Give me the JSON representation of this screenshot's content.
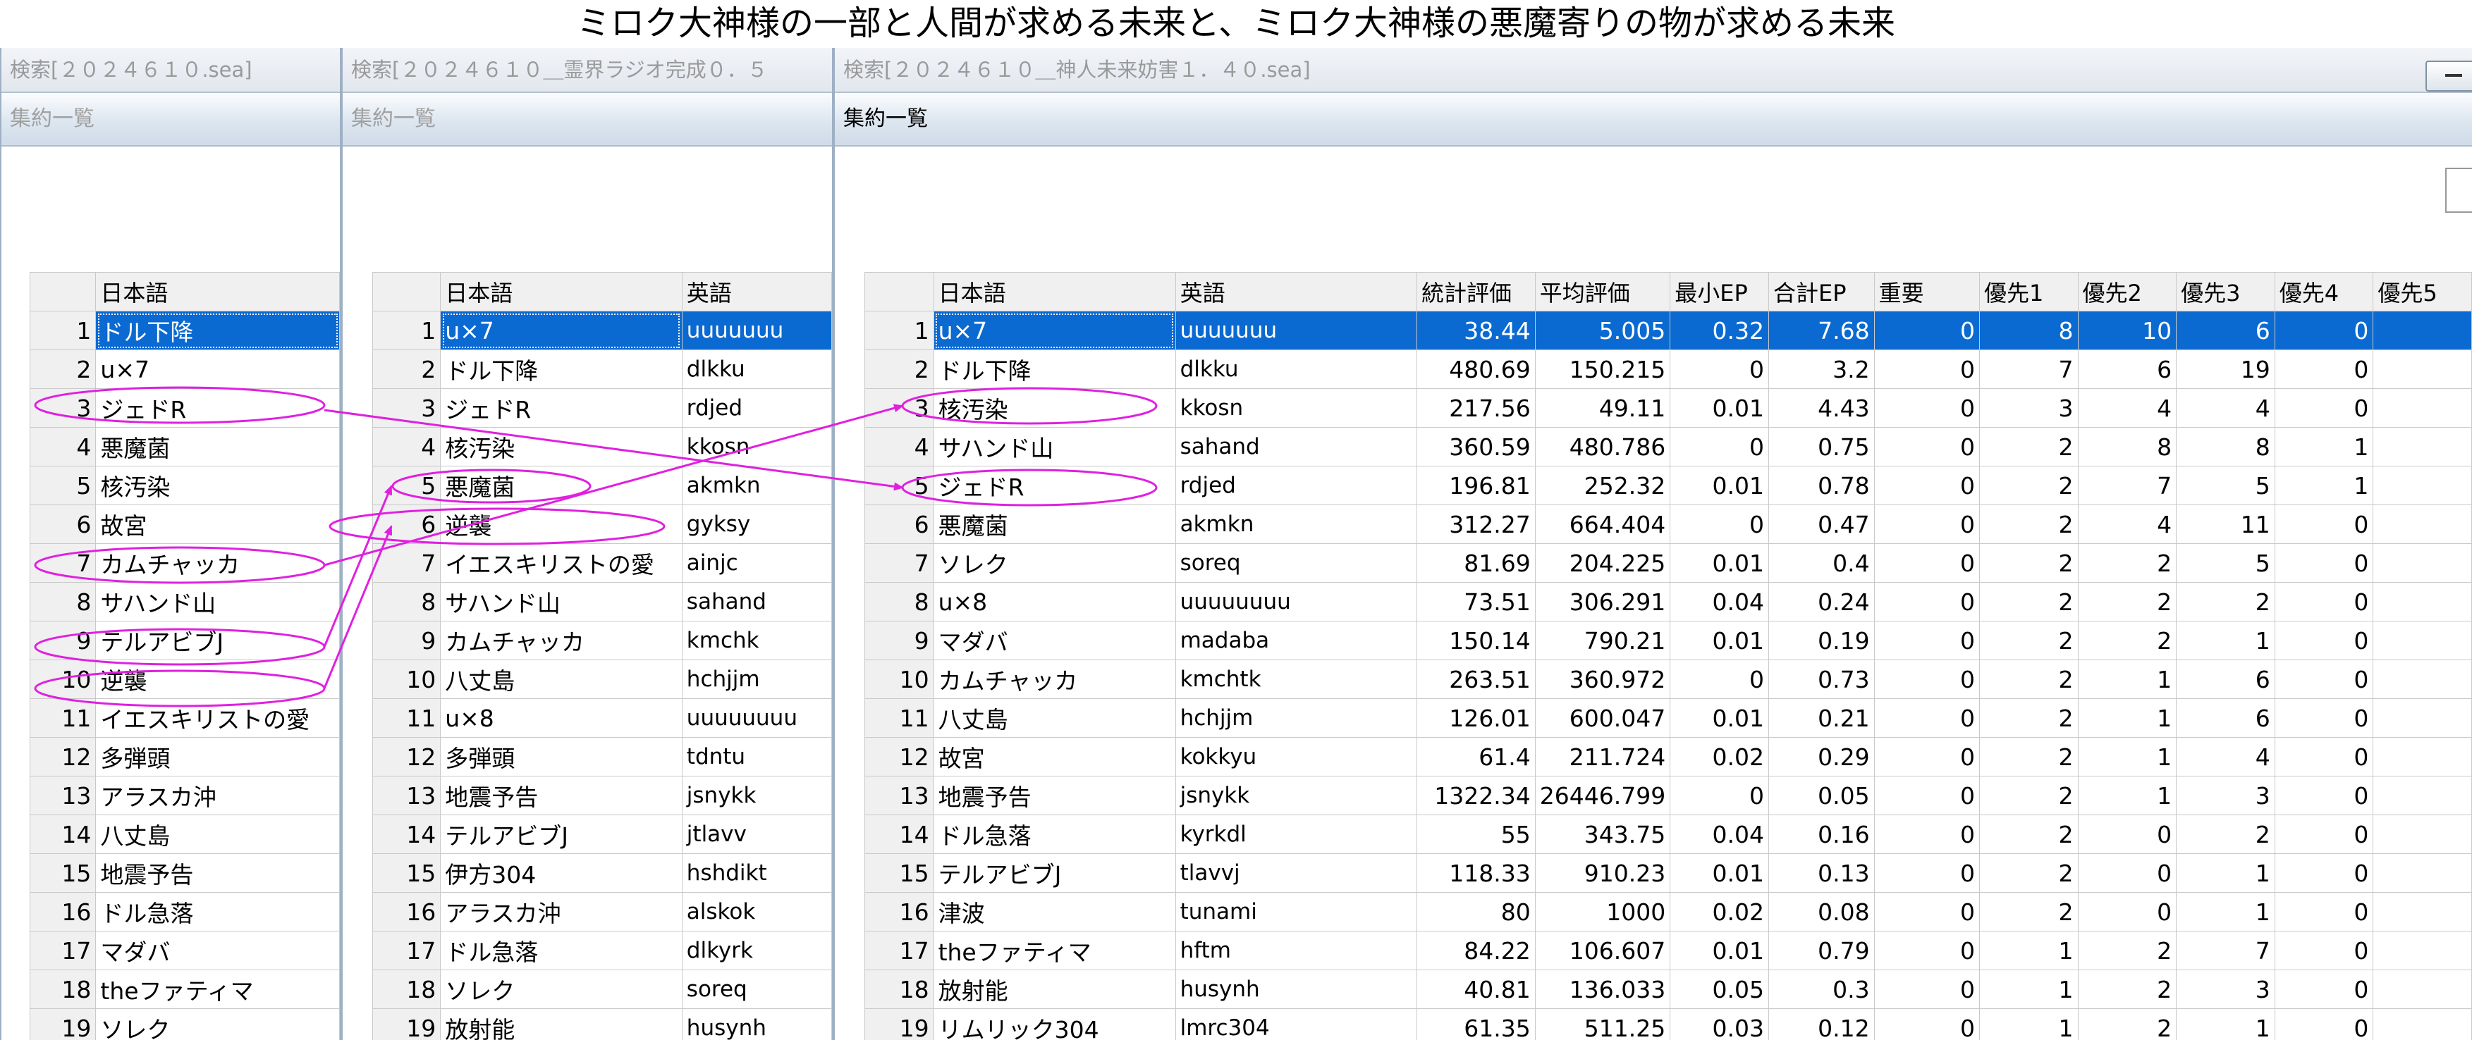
{
  "page_title": "ミロク大神様の一部と人間が求める未来と、ミロク大神様の悪魔寄りの物が求める未来",
  "colors": {
    "selection": "#0a6ad2",
    "annotation": "#e020e0"
  },
  "windows": [
    {
      "search_title": "検索[２０２４６１０.sea]",
      "panel_title": "集約一覧",
      "columns": [
        "日本語"
      ],
      "rows": [
        [
          "1",
          "ドル下降"
        ],
        [
          "2",
          "u×7"
        ],
        [
          "3",
          "ジェドR"
        ],
        [
          "4",
          "悪魔菌"
        ],
        [
          "5",
          "核汚染"
        ],
        [
          "6",
          "故宮"
        ],
        [
          "7",
          "カムチャッカ"
        ],
        [
          "8",
          "サハンド山"
        ],
        [
          "9",
          "テルアビブJ"
        ],
        [
          "10",
          "逆襲"
        ],
        [
          "11",
          "イエスキリストの愛"
        ],
        [
          "12",
          "多弾頭"
        ],
        [
          "13",
          "アラスカ沖"
        ],
        [
          "14",
          "八丈島"
        ],
        [
          "15",
          "地震予告"
        ],
        [
          "16",
          "ドル急落"
        ],
        [
          "17",
          "マダバ"
        ],
        [
          "18",
          "theファティマ"
        ],
        [
          "19",
          "ソレク"
        ]
      ]
    },
    {
      "search_title": "検索[２０２４６１０＿霊界ラジオ完成０．５",
      "panel_title": "集約一覧",
      "columns": [
        "日本語",
        "英語"
      ],
      "rows": [
        [
          "1",
          "u×7",
          "uuuuuuu"
        ],
        [
          "2",
          "ドル下降",
          "dlkku"
        ],
        [
          "3",
          "ジェドR",
          "rdjed"
        ],
        [
          "4",
          "核汚染",
          "kkosn"
        ],
        [
          "5",
          "悪魔菌",
          "akmkn"
        ],
        [
          "6",
          "逆襲",
          "gyksy"
        ],
        [
          "7",
          "イエスキリストの愛",
          "ainjc"
        ],
        [
          "8",
          "サハンド山",
          "sahand"
        ],
        [
          "9",
          "カムチャッカ",
          "kmchk"
        ],
        [
          "10",
          "八丈島",
          "hchjjm"
        ],
        [
          "11",
          "u×8",
          "uuuuuuuu"
        ],
        [
          "12",
          "多弾頭",
          "tdntu"
        ],
        [
          "13",
          "地震予告",
          "jsnykk"
        ],
        [
          "14",
          "テルアビブJ",
          "jtlavv"
        ],
        [
          "15",
          "伊方304",
          "hshdikt"
        ],
        [
          "16",
          "アラスカ沖",
          "alskok"
        ],
        [
          "17",
          "ドル急落",
          "dlkyrk"
        ],
        [
          "18",
          "ソレク",
          "soreq"
        ],
        [
          "19",
          "放射能",
          "husynh"
        ]
      ]
    },
    {
      "search_title": "検索[２０２４６１０＿神人未来妨害１．４０.sea]",
      "panel_title": "集約一覧",
      "columns": [
        "日本語",
        "英語",
        "統計評価",
        "平均評価",
        "最小EP",
        "合計EP",
        "重要",
        "優先1",
        "優先2",
        "優先3",
        "優先4",
        "優先5"
      ],
      "rows": [
        [
          "1",
          "u×7",
          "uuuuuuu",
          "38.44",
          "5.005",
          "0.32",
          "7.68",
          "0",
          "8",
          "10",
          "6",
          "0",
          ""
        ],
        [
          "2",
          "ドル下降",
          "dlkku",
          "480.69",
          "150.215",
          "0",
          "3.2",
          "0",
          "7",
          "6",
          "19",
          "0",
          ""
        ],
        [
          "3",
          "核汚染",
          "kkosn",
          "217.56",
          "49.11",
          "0.01",
          "4.43",
          "0",
          "3",
          "4",
          "4",
          "0",
          ""
        ],
        [
          "4",
          "サハンド山",
          "sahand",
          "360.59",
          "480.786",
          "0",
          "0.75",
          "0",
          "2",
          "8",
          "8",
          "1",
          ""
        ],
        [
          "5",
          "ジェドR",
          "rdjed",
          "196.81",
          "252.32",
          "0.01",
          "0.78",
          "0",
          "2",
          "7",
          "5",
          "1",
          ""
        ],
        [
          "6",
          "悪魔菌",
          "akmkn",
          "312.27",
          "664.404",
          "0",
          "0.47",
          "0",
          "2",
          "4",
          "11",
          "0",
          ""
        ],
        [
          "7",
          "ソレク",
          "soreq",
          "81.69",
          "204.225",
          "0.01",
          "0.4",
          "0",
          "2",
          "2",
          "5",
          "0",
          ""
        ],
        [
          "8",
          "u×8",
          "uuuuuuuu",
          "73.51",
          "306.291",
          "0.04",
          "0.24",
          "0",
          "2",
          "2",
          "2",
          "0",
          ""
        ],
        [
          "9",
          "マダバ",
          "madaba",
          "150.14",
          "790.21",
          "0.01",
          "0.19",
          "0",
          "2",
          "2",
          "1",
          "0",
          ""
        ],
        [
          "10",
          "カムチャッカ",
          "kmchtk",
          "263.51",
          "360.972",
          "0",
          "0.73",
          "0",
          "2",
          "1",
          "6",
          "0",
          ""
        ],
        [
          "11",
          "八丈島",
          "hchjjm",
          "126.01",
          "600.047",
          "0.01",
          "0.21",
          "0",
          "2",
          "1",
          "6",
          "0",
          ""
        ],
        [
          "12",
          "故宮",
          "kokkyu",
          "61.4",
          "211.724",
          "0.02",
          "0.29",
          "0",
          "2",
          "1",
          "4",
          "0",
          ""
        ],
        [
          "13",
          "地震予告",
          "jsnykk",
          "1322.34",
          "26446.799",
          "0",
          "0.05",
          "0",
          "2",
          "1",
          "3",
          "0",
          ""
        ],
        [
          "14",
          "ドル急落",
          "kyrkdl",
          "55",
          "343.75",
          "0.04",
          "0.16",
          "0",
          "2",
          "0",
          "2",
          "0",
          ""
        ],
        [
          "15",
          "テルアビブJ",
          "tlavvj",
          "118.33",
          "910.23",
          "0.01",
          "0.13",
          "0",
          "2",
          "0",
          "1",
          "0",
          ""
        ],
        [
          "16",
          "津波",
          "tunami",
          "80",
          "1000",
          "0.02",
          "0.08",
          "0",
          "2",
          "0",
          "1",
          "0",
          ""
        ],
        [
          "17",
          "theファティマ",
          "hftm",
          "84.22",
          "106.607",
          "0.01",
          "0.79",
          "0",
          "1",
          "2",
          "7",
          "0",
          ""
        ],
        [
          "18",
          "放射能",
          "husynh",
          "40.81",
          "136.033",
          "0.05",
          "0.3",
          "0",
          "1",
          "2",
          "3",
          "0",
          ""
        ],
        [
          "19",
          "リムリック304",
          "lmrc304",
          "61.35",
          "511.25",
          "0.03",
          "0.12",
          "0",
          "1",
          "2",
          "1",
          "0",
          ""
        ]
      ]
    }
  ]
}
